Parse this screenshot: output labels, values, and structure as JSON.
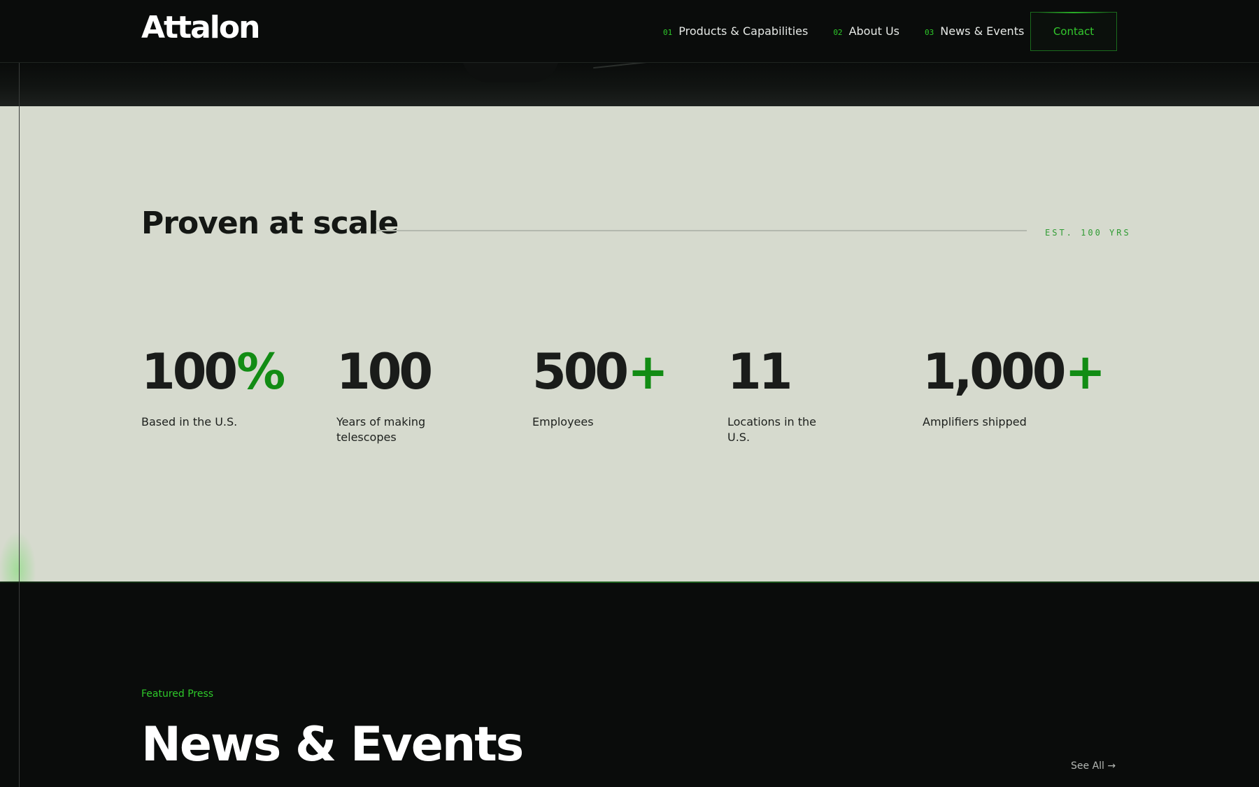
{
  "header": {
    "logo": "Attalon",
    "nav": [
      {
        "num": "01",
        "label": "Products & Capabilities"
      },
      {
        "num": "02",
        "label": "About Us"
      },
      {
        "num": "03",
        "label": "News & Events"
      }
    ],
    "contact_label": "Contact"
  },
  "stats": {
    "title": "Proven at scale",
    "tag": "EST. 100 YRS",
    "items": [
      {
        "value": "100",
        "suffix": "%",
        "label": "Based in the U.S."
      },
      {
        "value": "100",
        "suffix": "",
        "label": "Years of making telescopes"
      },
      {
        "value": "500",
        "suffix": "+",
        "label": "Employees"
      },
      {
        "value": "11",
        "suffix": "",
        "label": "Locations in the U.S."
      },
      {
        "value": "1,000",
        "suffix": "+",
        "label": "Amplifiers shipped"
      }
    ]
  },
  "news": {
    "eyebrow": "Featured Press",
    "title": "News & Events",
    "see_all": "See All →"
  },
  "colors": {
    "accent": "#2ec92a",
    "stats_bg": "#d6dace",
    "page_bg": "#0a0c0b"
  }
}
